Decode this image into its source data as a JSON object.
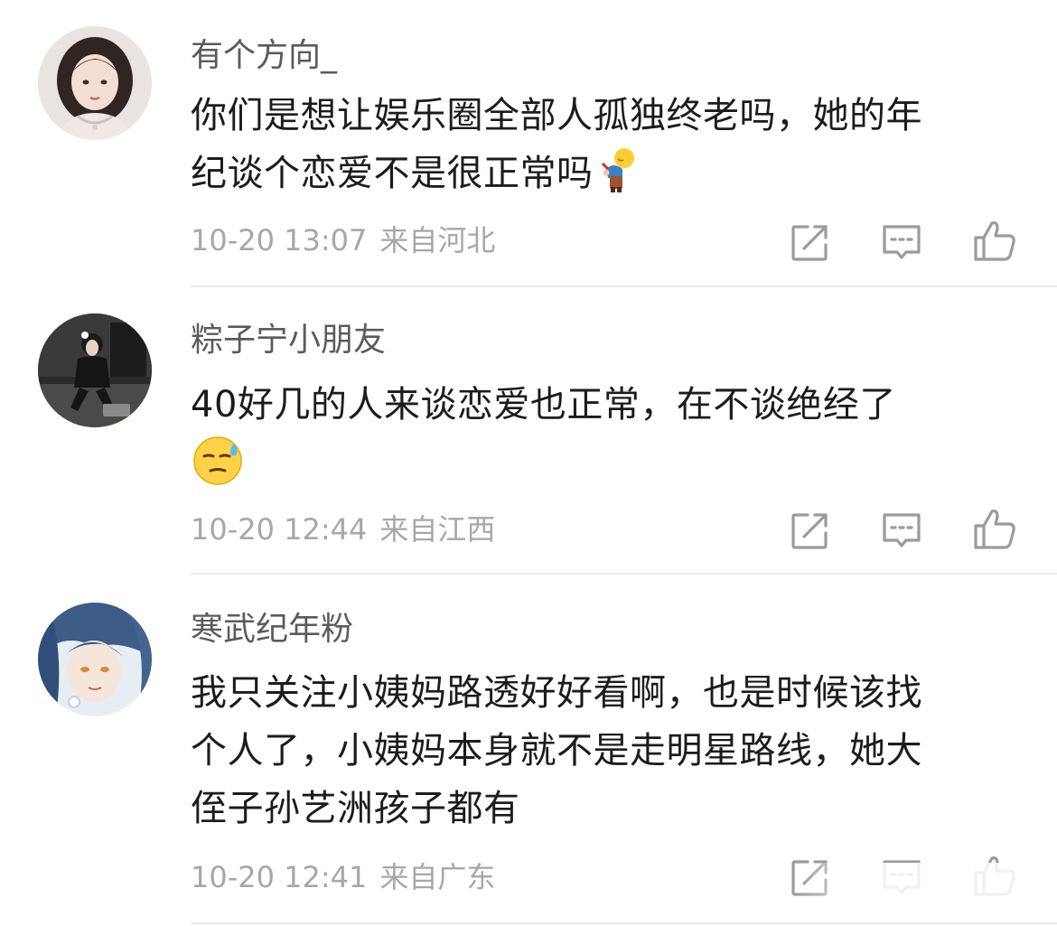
{
  "comments": [
    {
      "username": "有个方向_",
      "text_lines": [
        "你们是想让娱乐圈全部人孤独终老吗，她的年",
        "纪谈个恋爱不是很正常吗"
      ],
      "emoji_icon": "bowing-person-emoji",
      "time": "10-20 13:07",
      "location": "来自河北"
    },
    {
      "username": "粽子宁小朋友",
      "text_lines": [
        "40好几的人来谈恋爱也正常，在不谈绝经了"
      ],
      "emoji_icon": "sweat-face-emoji",
      "time": "10-20 12:44",
      "location": "来自江西"
    },
    {
      "username": "寒武纪年粉",
      "text_lines": [
        "我只关注小姨妈路透好好看啊，也是时候该找",
        "个人了，小姨妈本身就不是走明星路线，她大",
        "侄子孙艺洲孩子都有"
      ],
      "time": "10-20 12:41",
      "location": "来自广东"
    }
  ],
  "actions": {
    "share_icon": "share-icon",
    "reply_icon": "comment-icon",
    "like_icon": "thumbs-up-icon"
  },
  "colors": {
    "username": "#5b5b5b",
    "content": "#1c1c1c",
    "meta": "#a7a7a7",
    "icon": "#9b9b9b",
    "divider": "#ececec"
  }
}
